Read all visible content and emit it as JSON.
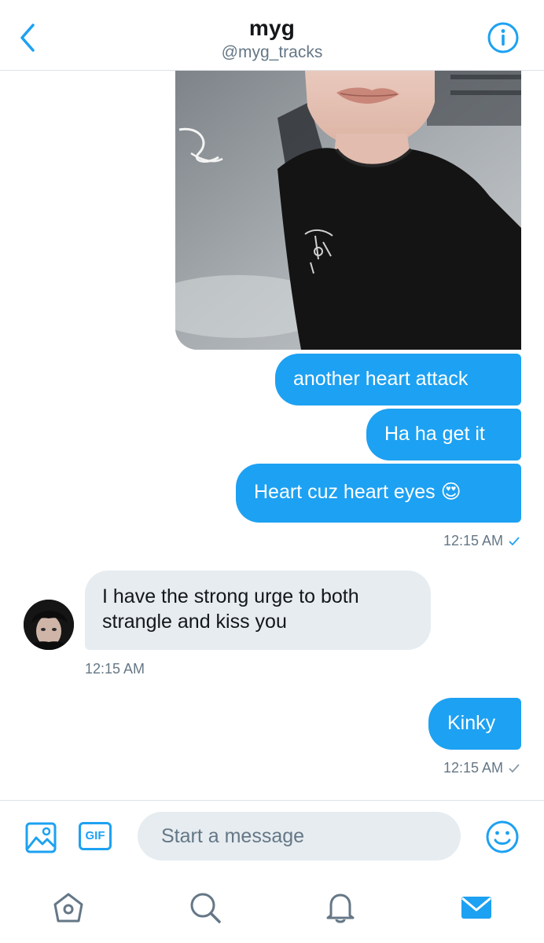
{
  "header": {
    "name": "myg",
    "handle": "@myg_tracks",
    "back_icon": "chevron-left-icon",
    "info_icon": "info-icon"
  },
  "colors": {
    "accent": "#1da1f2",
    "their_bubble": "#e6ecf0",
    "muted_text": "#657786"
  },
  "messages": {
    "m1": "another heart attack",
    "m2": "Ha ha get it",
    "m3": "Heart cuz heart eyes 😍",
    "time1": "12:15 AM",
    "m4": "I have the strong urge to both strangle and kiss you",
    "time2": "12:15 AM",
    "m5": "Kinky",
    "time3": "12:15 AM"
  },
  "composer": {
    "placeholder": "Start a message",
    "gif_label": "GIF",
    "media_icon": "image-icon",
    "emoji_icon": "smiley-icon"
  },
  "tabbar": {
    "icons": [
      "home-icon",
      "search-icon",
      "notifications-icon",
      "messages-icon"
    ],
    "active": "messages-icon"
  }
}
